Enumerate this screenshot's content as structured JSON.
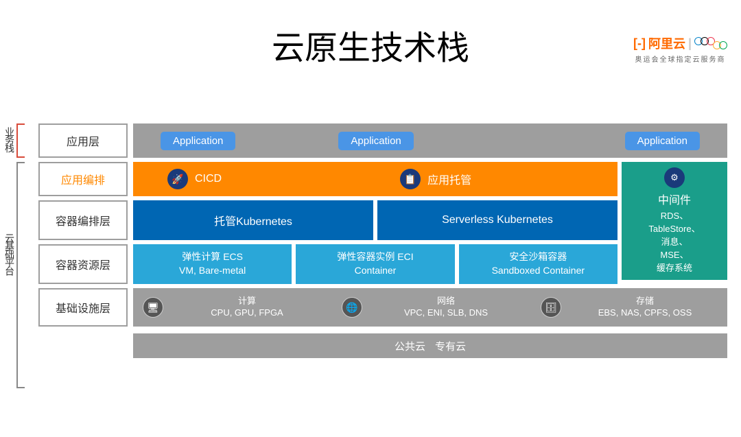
{
  "title": "云原生技术栈",
  "logo": {
    "brand": "阿里云",
    "tagline": "奥运会全球指定云服务商"
  },
  "brackets": {
    "top": "业务栈",
    "bottom": "云基础平台"
  },
  "rowLabels": {
    "app": "应用层",
    "orchestration": "应用编排",
    "container": "容器编排层",
    "resource": "容器资源层",
    "infra": "基础设施层"
  },
  "appRow": {
    "labels": [
      "Application",
      "Application",
      "Application"
    ]
  },
  "orchestration": {
    "cicd": "CICD",
    "hosting": "应用托管"
  },
  "kubernetes": {
    "managed": "托管Kubernetes",
    "serverless": "Serverless Kubernetes"
  },
  "resources": {
    "ecs": {
      "title": "弹性计算 ECS",
      "sub": "VM, Bare-metal"
    },
    "eci": {
      "title": "弹性容器实例 ECI",
      "sub": "Container"
    },
    "sandbox": {
      "title": "安全沙箱容器",
      "sub": "Sandboxed Container"
    }
  },
  "middleware": {
    "title": "中间件",
    "items": [
      "RDS、",
      "TableStore、",
      "消息、",
      "MSE、",
      "缓存系统"
    ]
  },
  "infra": {
    "compute": {
      "title": "计算",
      "sub": "CPU, GPU, FPGA"
    },
    "network": {
      "title": "网络",
      "sub": "VPC, ENI, SLB, DNS"
    },
    "storage": {
      "title": "存储",
      "sub": "EBS, NAS, CPFS, OSS"
    }
  },
  "cloud": {
    "public": "公共云",
    "private": "专有云"
  }
}
